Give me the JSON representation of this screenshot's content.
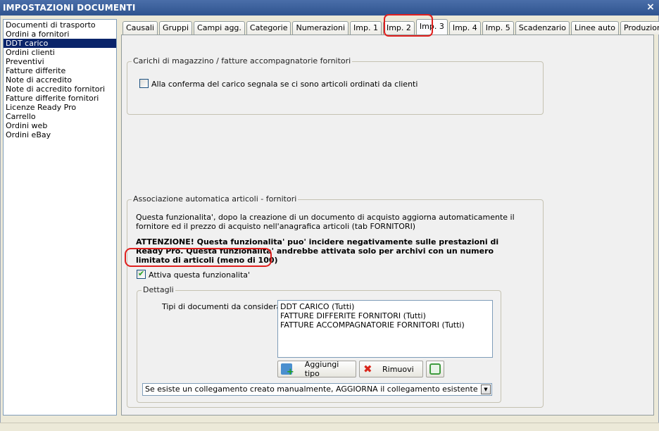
{
  "window": {
    "title": "IMPOSTAZIONI DOCUMENTI",
    "close_label": "×"
  },
  "sidebar": {
    "items": [
      {
        "label": "Documenti di trasporto"
      },
      {
        "label": "Ordini a fornitori"
      },
      {
        "label": "DDT carico",
        "selected": true
      },
      {
        "label": "Ordini clienti"
      },
      {
        "label": "Preventivi"
      },
      {
        "label": "Fatture differite"
      },
      {
        "label": "Note di accredito"
      },
      {
        "label": "Note di accredito fornitori"
      },
      {
        "label": "Fatture differite fornitori"
      },
      {
        "label": "Licenze Ready Pro"
      },
      {
        "label": "Carrello"
      },
      {
        "label": "Ordini web"
      },
      {
        "label": "Ordini eBay"
      }
    ]
  },
  "tabs": [
    {
      "label": "Causali"
    },
    {
      "label": "Gruppi"
    },
    {
      "label": "Campi agg."
    },
    {
      "label": "Categorie"
    },
    {
      "label": "Numerazioni"
    },
    {
      "label": "Imp. 1"
    },
    {
      "label": "Imp. 2"
    },
    {
      "label": "Imp. 3",
      "active": true
    },
    {
      "label": "Imp. 4"
    },
    {
      "label": "Imp. 5"
    },
    {
      "label": "Scadenzario"
    },
    {
      "label": "Linee auto"
    },
    {
      "label": "Produzione"
    }
  ],
  "carichi": {
    "title": "Carichi di magazzino / fatture accompagnatorie fornitori",
    "checkbox_label": "Alla conferma del carico segnala se ci sono articoli ordinati da clienti",
    "checked": false
  },
  "associazione": {
    "title": "Associazione automatica articoli - fornitori",
    "description_1": "Questa funzionalita', dopo la creazione di un documento di acquisto aggiorna automaticamente il",
    "description_2": "fornitore ed il prezzo di acquisto nell'anagrafica articoli (tab FORNITORI)",
    "warning_1": "ATTENZIONE! Questa funzionalita' puo' incidere negativamente sulle prestazioni di",
    "warning_2": "Ready Pro. Questa funzionalita' andrebbe attivata solo per archivi con un numero",
    "warning_3": "limitato di articoli (meno di 100)",
    "enable_label": "Attiva questa funzionalita'",
    "enabled": true
  },
  "dettagli": {
    "title": "Dettagli",
    "doc_types_label": "Tipi di documenti da considerare:",
    "doc_types": [
      "DDT CARICO (Tutti)",
      "FATTURE DIFFERITE FORNITORI (Tutti)",
      "FATTURE ACCOMPAGNATORIE FORNITORI (Tutti)"
    ],
    "add_button": "Aggiungi tipo",
    "remove_button": "Rimuovi",
    "link_option": "Se esiste un collegamento creato manualmente, AGGIORNA il collegamento esistente"
  },
  "colors": {
    "titlebar": "#2f548f",
    "selection": "#0a246a",
    "highlight": "#e0201e",
    "check": "#21a121"
  }
}
